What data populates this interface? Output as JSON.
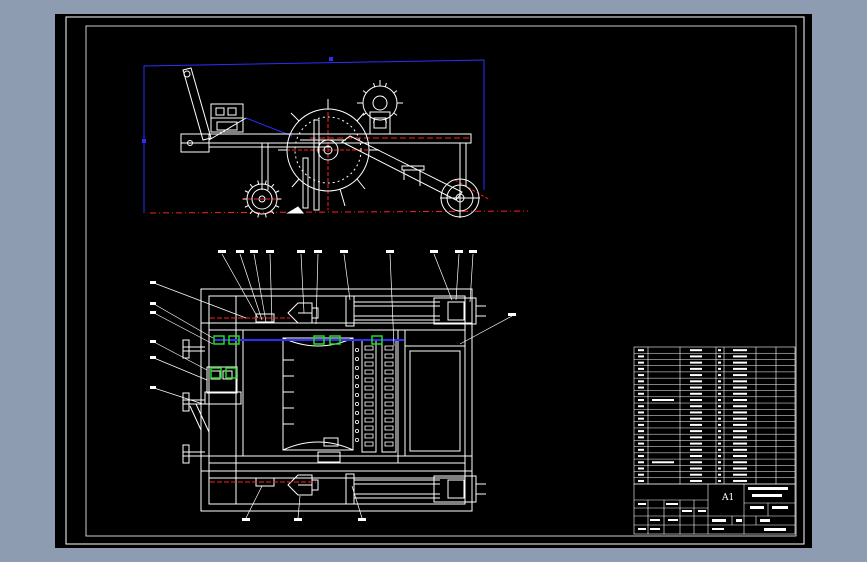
{
  "title_block": {
    "sheet_size": "A1"
  },
  "colors": {
    "background": "#000000",
    "frame": "#ffffff",
    "center_line": "#ff2020",
    "blue_outline": "#2d2dff",
    "part": "#ffffff",
    "highlight": "#22dd22"
  }
}
